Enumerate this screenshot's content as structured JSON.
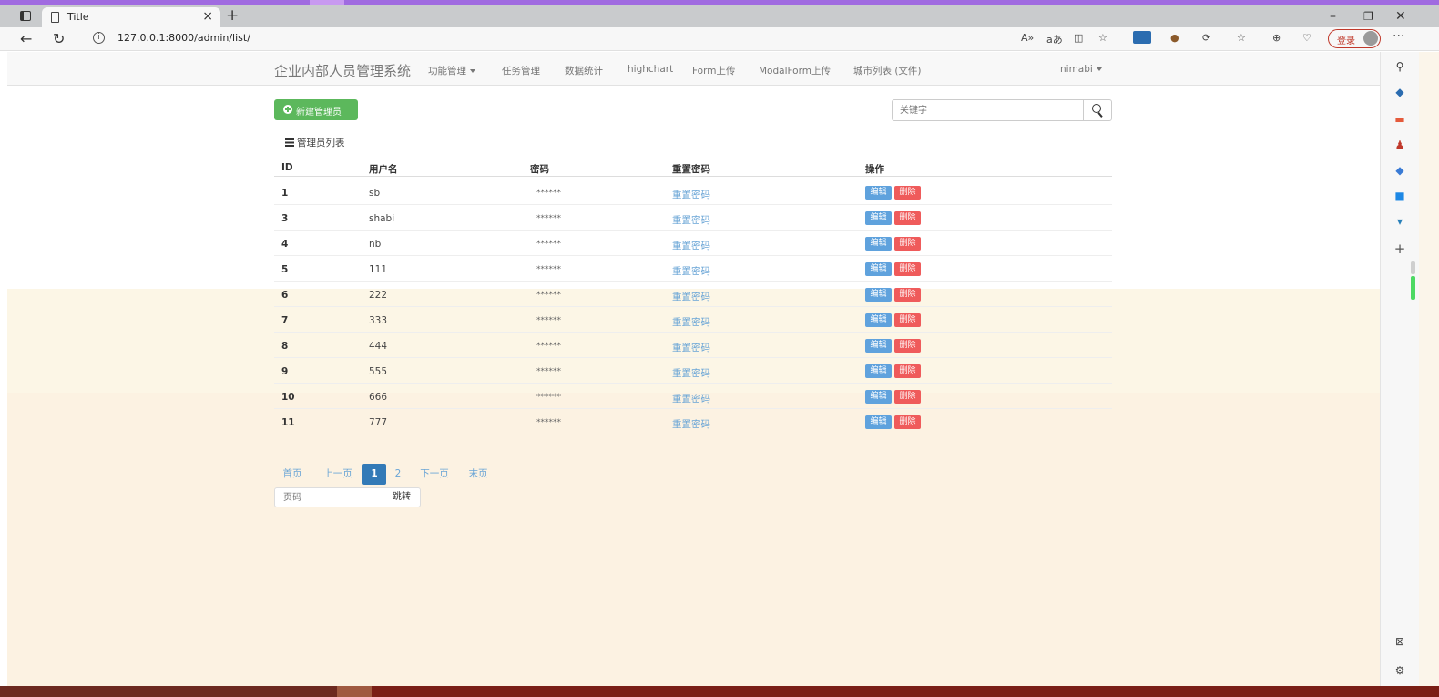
{
  "browser": {
    "tab_title": "Title",
    "url": "127.0.0.1:8000/admin/list/",
    "login_label": "登录",
    "toolbar_labels": [
      "A»",
      "aあ"
    ]
  },
  "navbar": {
    "brand": "企业内部人员管理系统",
    "items": [
      "功能管理",
      "任务管理",
      "数据统计",
      "highchart",
      "Form上传",
      "ModalForm上传",
      "城市列表 (文件)"
    ],
    "user": "nimabi"
  },
  "actions": {
    "new_button": "新建管理员",
    "search_placeholder": "关键字"
  },
  "panel": {
    "title": "管理员列表"
  },
  "table": {
    "headers": [
      "ID",
      "用户名",
      "密码",
      "重置密码",
      "操作"
    ],
    "rows": [
      {
        "id": "1",
        "name": "sb",
        "pwd": "******",
        "reset": "重置密码",
        "edit": "编辑",
        "del": "删除"
      },
      {
        "id": "3",
        "name": "shabi",
        "pwd": "******",
        "reset": "重置密码",
        "edit": "编辑",
        "del": "删除"
      },
      {
        "id": "4",
        "name": "nb",
        "pwd": "******",
        "reset": "重置密码",
        "edit": "编辑",
        "del": "删除"
      },
      {
        "id": "5",
        "name": "111",
        "pwd": "******",
        "reset": "重置密码",
        "edit": "编辑",
        "del": "删除"
      },
      {
        "id": "6",
        "name": "222",
        "pwd": "******",
        "reset": "重置密码",
        "edit": "编辑",
        "del": "删除"
      },
      {
        "id": "7",
        "name": "333",
        "pwd": "******",
        "reset": "重置密码",
        "edit": "编辑",
        "del": "删除"
      },
      {
        "id": "8",
        "name": "444",
        "pwd": "******",
        "reset": "重置密码",
        "edit": "编辑",
        "del": "删除"
      },
      {
        "id": "9",
        "name": "555",
        "pwd": "******",
        "reset": "重置密码",
        "edit": "编辑",
        "del": "删除"
      },
      {
        "id": "10",
        "name": "666",
        "pwd": "******",
        "reset": "重置密码",
        "edit": "编辑",
        "del": "删除"
      },
      {
        "id": "11",
        "name": "777",
        "pwd": "******",
        "reset": "重置密码",
        "edit": "编辑",
        "del": "删除"
      }
    ]
  },
  "pagination": {
    "first": "首页",
    "prev": "上一页",
    "pages": [
      "1",
      "2"
    ],
    "current": "1",
    "next": "下一页",
    "last": "末页",
    "jump_placeholder": "页码",
    "jump_button": "跳转"
  }
}
